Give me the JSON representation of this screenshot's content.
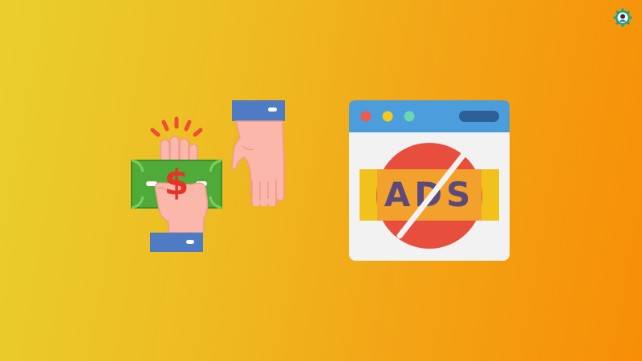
{
  "banner": {
    "ads_label": "ADS",
    "currency_symbol": "$"
  },
  "icons": {
    "corner_badge": "gear-badge-icon",
    "money_hand": "hand-holding-cash-icon",
    "receiving_hand": "open-hand-icon",
    "browser": "browser-window-icon",
    "no_sign": "prohibition-sign-icon"
  },
  "colors": {
    "gradient_start": "#e9cf2e",
    "gradient_end": "#f78e06",
    "browser_bar": "#4b9ddb",
    "browser_body": "#f2f2f2",
    "no_sign_red": "#e84e3e",
    "ads_band": "#f1c21b",
    "ads_text": "#5c4a7a",
    "cash_green": "#4faa3a",
    "cuff_blue": "#4f7bc4",
    "skin": "#fbb7a9"
  }
}
